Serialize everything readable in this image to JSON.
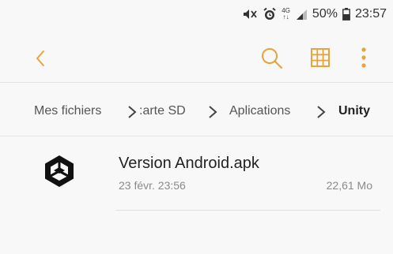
{
  "status_bar": {
    "network_label_top": "4G",
    "network_label_bottom": "↑↓",
    "battery": "50%",
    "time": "23:57"
  },
  "toolbar": {
    "back_icon": "chevron-left-icon",
    "search_icon": "search-icon",
    "grid_icon": "grid-view-icon",
    "more_icon": "more-vertical-icon",
    "accent_color": "#e8a33c"
  },
  "breadcrumb": {
    "items": [
      {
        "label": "Mes fichiers"
      },
      {
        "label": ":arte SD"
      },
      {
        "label": "Aplications"
      },
      {
        "label": "Unity"
      }
    ]
  },
  "files": [
    {
      "name": "Version Android.apk",
      "date": "23 févr. 23:56",
      "size": "22,61 Mo",
      "icon": "unity-logo-icon"
    }
  ]
}
